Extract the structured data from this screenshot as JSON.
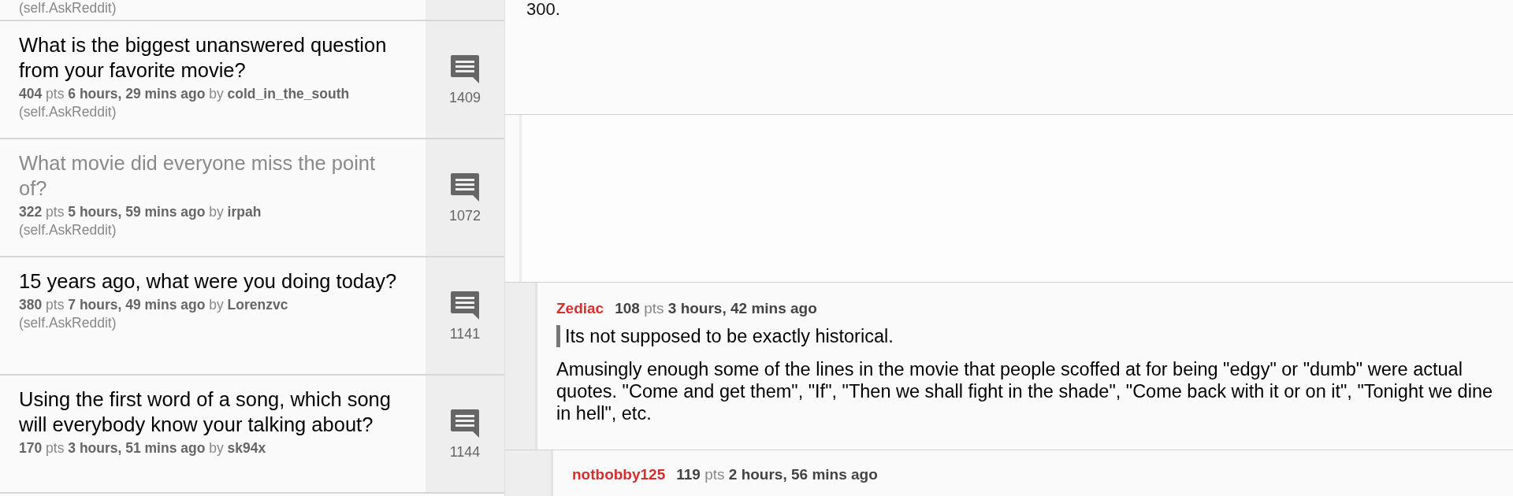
{
  "top_fragment": {
    "subreddit": "(self.AskReddit)"
  },
  "posts": [
    {
      "title": "What is the biggest unanswered question from your favorite movie?",
      "points": "404",
      "pts_label": "pts",
      "age": "6 hours, 29 mins ago",
      "by_label": "by",
      "author": "cold_in_the_south",
      "subreddit": "(self.AskReddit)",
      "comments": "1409",
      "read": false
    },
    {
      "title": "What movie did everyone miss the point of?",
      "points": "322",
      "pts_label": "pts",
      "age": "5 hours, 59 mins ago",
      "by_label": "by",
      "author": "irpah",
      "subreddit": "(self.AskReddit)",
      "comments": "1072",
      "read": true
    },
    {
      "title": "15 years ago, what were you doing today?",
      "points": "380",
      "pts_label": "pts",
      "age": "7 hours, 49 mins ago",
      "by_label": "by",
      "author": "Lorenzvc",
      "subreddit": "(self.AskReddit)",
      "comments": "1141",
      "read": false
    },
    {
      "title": "Using the first word of a song, which song will everybody know your talking about?",
      "points": "170",
      "pts_label": "pts",
      "age": "3 hours, 51 mins ago",
      "by_label": "by",
      "author": "sk94x",
      "comments": "1144",
      "read": false
    }
  ],
  "comments": [
    {
      "kind": "fragment",
      "text": "300."
    },
    {
      "kind": "faded"
    },
    {
      "kind": "full",
      "author": "Zediac",
      "points": "108",
      "pts_label": "pts",
      "age": "3 hours, 42 mins ago",
      "quote": "Its not supposed to be exactly historical.",
      "body": "Amusingly enough some of the lines in the movie that people scoffed at for being \"edgy\" or \"dumb\" were actual quotes. \"Come and get them\", \"If\", \"Then we shall fight in the shade\", \"Come back with it or on it\", \"Tonight we dine in hell\", etc."
    },
    {
      "kind": "header",
      "author": "notbobby125",
      "points": "119",
      "pts_label": "pts",
      "age": "2 hours, 56 mins ago"
    }
  ]
}
